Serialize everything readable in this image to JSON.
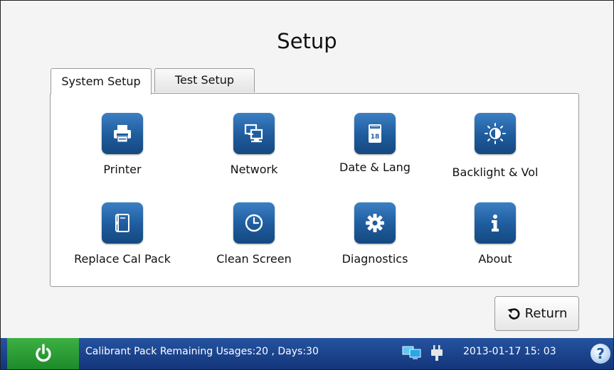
{
  "screen": {
    "title": "Setup"
  },
  "tabs": [
    {
      "label": "System Setup",
      "active": true
    },
    {
      "label": "Test Setup",
      "active": false
    }
  ],
  "items": [
    {
      "label": "Printer",
      "icon": "printer-icon"
    },
    {
      "label": "Network",
      "icon": "network-icon"
    },
    {
      "label": "Date & Lang",
      "icon": "calendar-icon",
      "icon_text": "18"
    },
    {
      "label": "Backlight & Vol",
      "icon": "brightness-icon"
    },
    {
      "label": "Replace Cal Pack",
      "icon": "cal-pack-icon"
    },
    {
      "label": "Clean Screen",
      "icon": "clock-icon"
    },
    {
      "label": "Diagnostics",
      "icon": "gear-icon"
    },
    {
      "label": "About",
      "icon": "info-icon"
    }
  ],
  "return_button": {
    "label": "Return",
    "icon": "return-arrow-icon"
  },
  "status": {
    "message": "Calibrant Pack Remaining Usages:20 , Days:30",
    "datetime": "2013-01-17  15: 03",
    "help_glyph": "?"
  },
  "colors": {
    "icon_blue": "#1f5d9e",
    "status_bar_blue": "#1c4590",
    "power_green": "#2e9e36"
  }
}
